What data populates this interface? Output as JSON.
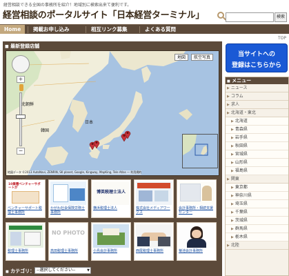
{
  "header": {
    "tagline": "経営相談できる全国の事務所を紹介！地域別に検索出来て便利です。",
    "site_title": "経営相談のポータルサイト「日本経営ターミナル」",
    "search_button": "検索"
  },
  "nav": {
    "items": [
      "Home",
      "掲載お申し込み",
      "相互リンク募集",
      "よくある質問"
    ],
    "top_link": "TOP"
  },
  "main": {
    "heading": "最新登録店舗",
    "map": {
      "type_buttons": [
        "地図",
        "航空写真"
      ],
      "labels": {
        "north_korea": "北朝鮮",
        "south_korea": "韓国",
        "japan": "日本"
      },
      "credit": "地図データ ©2013 AutoNavi, ZENRIN, SK planet, Google, Kingway, MapKing, Tele Atlas — 利用規約"
    },
    "thumbnails": [
      {
        "caption": "ベンチャーサポート税理士事務所",
        "img_text": "10業種ベンチャーサポートが"
      },
      {
        "caption": "かがわ社会保険労務士事務所",
        "img_text": ""
      },
      {
        "caption": "横浜税理士法人",
        "img_text": "博英税理士法人"
      },
      {
        "caption": "株式会社メディアワークス",
        "img_text": ""
      },
      {
        "caption": "会計事務所・相続支援センター",
        "img_text": ""
      },
      {
        "caption": "税理士事務所",
        "img_text": ""
      },
      {
        "caption": "高田税理士事務所",
        "img_text": "NO PHOTO"
      },
      {
        "caption": "小島会計事務所",
        "img_text": ""
      },
      {
        "caption": "西尾税理士事務所",
        "img_text": ""
      },
      {
        "caption": "菊池会計事務所",
        "img_text": ""
      }
    ],
    "category": {
      "label": "カテゴリ：",
      "selected": "--選択してください--"
    }
  },
  "register_banner": {
    "line1": "当サイトへの",
    "line2": "登録はこちらから"
  },
  "sidebar": {
    "title": "メニュー",
    "items": [
      {
        "label": "ニュース",
        "type": "cat"
      },
      {
        "label": "コラム",
        "type": "cat"
      },
      {
        "label": "求人",
        "type": "cat"
      },
      {
        "label": "北海道・東北",
        "type": "cat"
      },
      {
        "label": "北海道",
        "type": "sub"
      },
      {
        "label": "青森県",
        "type": "sub"
      },
      {
        "label": "岩手県",
        "type": "sub"
      },
      {
        "label": "秋田県",
        "type": "sub"
      },
      {
        "label": "宮城県",
        "type": "sub"
      },
      {
        "label": "山形県",
        "type": "sub"
      },
      {
        "label": "福島県",
        "type": "sub"
      },
      {
        "label": "関東",
        "type": "cat"
      },
      {
        "label": "東京都",
        "type": "sub"
      },
      {
        "label": "神奈川県",
        "type": "sub"
      },
      {
        "label": "埼玉県",
        "type": "sub"
      },
      {
        "label": "千葉県",
        "type": "sub"
      },
      {
        "label": "茨城県",
        "type": "sub"
      },
      {
        "label": "群馬県",
        "type": "sub"
      },
      {
        "label": "栃木県",
        "type": "sub"
      },
      {
        "label": "北陸",
        "type": "cat"
      }
    ]
  },
  "colors": {
    "nav_bg": "#5c4a3a",
    "nav_active": "#c3a87e",
    "banner": "#1a59d5",
    "sidebar_bg": "#f6f1e8"
  }
}
